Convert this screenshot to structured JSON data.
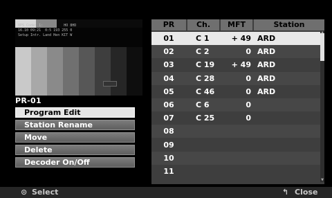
{
  "preview": {
    "overlay_line1": "VPS Code: 1:          HO 8HD",
    "overlay_line2": "16.10 09:21  0:5 193 255 0",
    "overlay_line3": "Setup Intr. Land Hen KIT W",
    "bar_colors": [
      "#c9c9c9",
      "#a8a8a8",
      "#8a8a8a",
      "#707070",
      "#575757",
      "#3e3e3e",
      "#262626",
      "#0e0e0e"
    ]
  },
  "current_program": "PR-01",
  "menu": [
    {
      "label": "Program Edit",
      "selected": true
    },
    {
      "label": "Station Rename",
      "selected": false
    },
    {
      "label": "Move",
      "selected": false
    },
    {
      "label": "Delete",
      "selected": false
    },
    {
      "label": "Decoder On/Off",
      "selected": false
    }
  ],
  "table": {
    "headers": {
      "pr": "PR",
      "ch": "Ch.",
      "mft": "MFT",
      "station": "Station"
    },
    "rows": [
      {
        "pr": "01",
        "ch": "C 1",
        "mft": "+ 49",
        "station": "ARD",
        "selected": true
      },
      {
        "pr": "02",
        "ch": "C 2",
        "mft": "0",
        "station": "ARD"
      },
      {
        "pr": "03",
        "ch": "C 19",
        "mft": "+ 49",
        "station": "ARD"
      },
      {
        "pr": "04",
        "ch": "C 28",
        "mft": "0",
        "station": "ARD"
      },
      {
        "pr": "05",
        "ch": "C 46",
        "mft": "0",
        "station": "ARD"
      },
      {
        "pr": "06",
        "ch": "C 6",
        "mft": "0",
        "station": ""
      },
      {
        "pr": "07",
        "ch": "C 25",
        "mft": "0",
        "station": ""
      },
      {
        "pr": "08",
        "ch": "",
        "mft": "",
        "station": ""
      },
      {
        "pr": "09",
        "ch": "",
        "mft": "",
        "station": ""
      },
      {
        "pr": "10",
        "ch": "",
        "mft": "",
        "station": ""
      },
      {
        "pr": "11",
        "ch": "",
        "mft": "",
        "station": ""
      }
    ]
  },
  "footer": {
    "select_icon": "select-button-icon",
    "select_label": "Select",
    "close_icon": "return-arrow-icon",
    "close_label": "Close"
  },
  "colors": {
    "selected_bg": "#e9e9e9",
    "menu_bg": "#6e6e6e",
    "table_bg": "#3e3e3e"
  }
}
